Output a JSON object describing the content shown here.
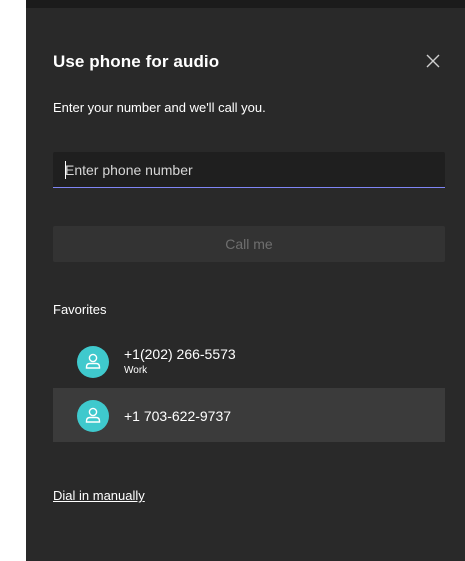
{
  "dialog": {
    "title": "Use phone for audio",
    "subtitle": "Enter your number and we'll call you.",
    "close_icon": "close-icon"
  },
  "phone_input": {
    "placeholder": "Enter phone number",
    "value": ""
  },
  "call_button": {
    "label": "Call me",
    "state": "disabled"
  },
  "favorites": {
    "label": "Favorites",
    "items": [
      {
        "number": "+1(202) 266-5573",
        "type": "Work",
        "icon": "person-icon"
      },
      {
        "number": "+1 703-622-9737",
        "type": "",
        "icon": "person-icon"
      }
    ]
  },
  "dial_manually": {
    "label": "Dial in manually"
  },
  "colors": {
    "panel_bg": "#292929",
    "accent": "#7f85f5",
    "avatar": "#3fc9cd",
    "hover_row": "#3b3b3b"
  }
}
